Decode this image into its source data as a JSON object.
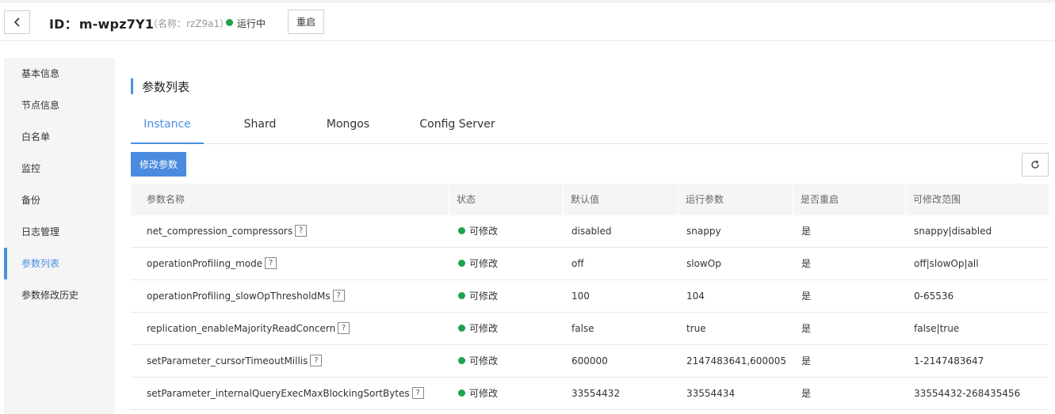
{
  "header": {
    "id_label": "ID：",
    "id_value": "m-wpz7Y1",
    "name_sub": "（名称：rzZ9a1）",
    "status": "运行中",
    "restart_label": "重启",
    "status_color": "#1fa34a"
  },
  "sidebar": {
    "items": [
      {
        "label": "基本信息"
      },
      {
        "label": "节点信息"
      },
      {
        "label": "白名单"
      },
      {
        "label": "监控"
      },
      {
        "label": "备份"
      },
      {
        "label": "日志管理"
      },
      {
        "label": "参数列表",
        "active": true
      },
      {
        "label": "参数修改历史"
      }
    ],
    "accent": "#4a90e2"
  },
  "main": {
    "section_title": "参数列表",
    "tabs": [
      {
        "label": "Instance",
        "active": true
      },
      {
        "label": "Shard"
      },
      {
        "label": "Mongos"
      },
      {
        "label": "Config Server"
      }
    ],
    "modify_button": "修改参数",
    "refresh_icon": "refresh-icon",
    "table": {
      "headers": [
        "参数名称",
        "状态",
        "默认值",
        "运行参数",
        "是否重启",
        "可修改范围"
      ],
      "help_icon_text": "?",
      "rows": [
        {
          "name": "net_compression_compressors",
          "status": "可修改",
          "default": "disabled",
          "running": "snappy",
          "restart": "是",
          "range": "snappy|disabled"
        },
        {
          "name": "operationProfiling_mode",
          "status": "可修改",
          "default": "off",
          "running": "slowOp",
          "restart": "是",
          "range": "off|slowOp|all"
        },
        {
          "name": "operationProfiling_slowOpThresholdMs",
          "status": "可修改",
          "default": "100",
          "running": "104",
          "restart": "是",
          "range": "0-65536"
        },
        {
          "name": "replication_enableMajorityReadConcern",
          "status": "可修改",
          "default": "false",
          "running": "true",
          "restart": "是",
          "range": "false|true"
        },
        {
          "name": "setParameter_cursorTimeoutMillis",
          "status": "可修改",
          "default": "600000",
          "running": "2147483641,600005",
          "restart": "是",
          "range": "1-2147483647"
        },
        {
          "name": "setParameter_internalQueryExecMaxBlockingSortBytes",
          "status": "可修改",
          "default": "33554432",
          "running": "33554434",
          "restart": "是",
          "range": "33554432-268435456"
        }
      ]
    }
  }
}
